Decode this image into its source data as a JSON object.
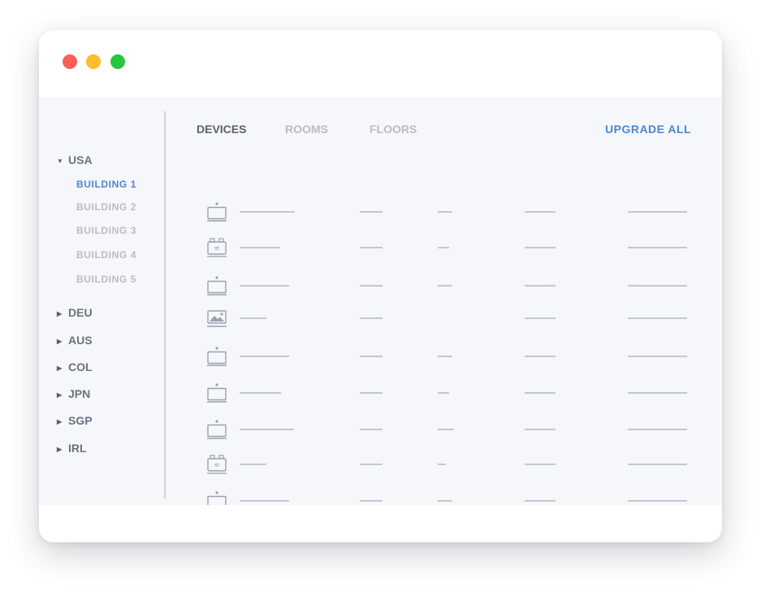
{
  "sidebar": {
    "countries": [
      {
        "label": "USA",
        "expanded": true,
        "buildings": [
          {
            "label": "BUILDING 1",
            "active": true
          },
          {
            "label": "BUILDING 2",
            "active": false
          },
          {
            "label": "BUILDING 3",
            "active": false
          },
          {
            "label": "BUILDING 4",
            "active": false
          },
          {
            "label": "BUILDING 5",
            "active": false
          }
        ]
      },
      {
        "label": "DEU",
        "expanded": false
      },
      {
        "label": "AUS",
        "expanded": false
      },
      {
        "label": "COL",
        "expanded": false
      },
      {
        "label": "JPN",
        "expanded": false
      },
      {
        "label": "SGP",
        "expanded": false
      },
      {
        "label": "IRL",
        "expanded": false
      }
    ]
  },
  "tabs": [
    {
      "label": "DEVICES",
      "active": true
    },
    {
      "label": "ROOMS",
      "active": false
    },
    {
      "label": "FLOORS",
      "active": false
    }
  ],
  "actions": {
    "upgrade_all": "UPGRADE ALL"
  },
  "devices": [
    {
      "icon": "laptop-icon"
    },
    {
      "icon": "router-icon"
    },
    {
      "icon": "laptop-icon"
    },
    {
      "icon": "image-icon"
    },
    {
      "icon": "laptop-icon"
    },
    {
      "icon": "laptop-icon"
    },
    {
      "icon": "laptop-icon"
    },
    {
      "icon": "router-icon"
    },
    {
      "icon": "laptop-icon"
    },
    {
      "icon": "laptop-icon"
    }
  ],
  "colors": {
    "accent": "#4a86d3",
    "muted": "#b9bcc6",
    "text": "#6c7180",
    "panel": "#f5f7fb"
  }
}
